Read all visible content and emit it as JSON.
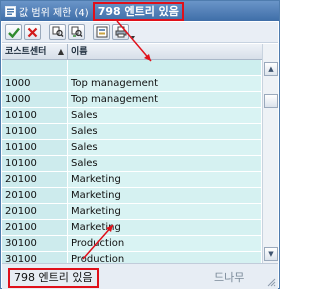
{
  "window": {
    "title": "값 범위 제한 (4)",
    "entry_count": "798 엔트리 있음"
  },
  "toolbar": {
    "buttons": [
      {
        "icon": "checkmark-icon",
        "color": "#2f8a2f"
      },
      {
        "icon": "cancel-icon",
        "color": "#d21a1a"
      },
      {
        "icon": "find-icon",
        "color": "#303030"
      },
      {
        "icon": "find-next-icon",
        "color": "#303030"
      },
      {
        "icon": "expand-icon",
        "color": "#303030"
      },
      {
        "icon": "print-icon",
        "color": "#303030"
      }
    ]
  },
  "table": {
    "columns": [
      "코스트센터",
      "이름"
    ],
    "rows": [
      [
        "1000",
        "Top management"
      ],
      [
        "1000",
        "Top management"
      ],
      [
        "10100",
        "Sales"
      ],
      [
        "10100",
        "Sales"
      ],
      [
        "10100",
        "Sales"
      ],
      [
        "10100",
        "Sales"
      ],
      [
        "20100",
        "Marketing"
      ],
      [
        "20100",
        "Marketing"
      ],
      [
        "20100",
        "Marketing"
      ],
      [
        "20100",
        "Marketing"
      ],
      [
        "30100",
        "Production"
      ],
      [
        "30100",
        "Production"
      ]
    ]
  },
  "statusbar": {
    "text": "798 엔트리 있음"
  },
  "watermark": {
    "text": "드나무"
  },
  "colors": {
    "titlebar": "#4f7cae",
    "highlight_box": "#e0101a",
    "row_fill": "#d5f1f1"
  }
}
